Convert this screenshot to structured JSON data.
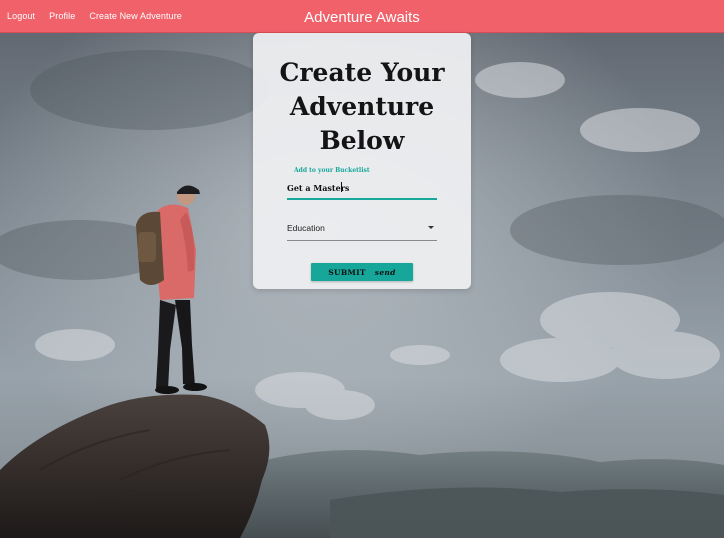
{
  "navbar": {
    "links": [
      "Logout",
      "Profile",
      "Create New Adventure"
    ],
    "brand": "Adventure Awaits",
    "color": "#f0616a"
  },
  "card": {
    "title_lines": [
      "Create Your",
      "Adventure",
      "Below"
    ],
    "field_label": "Add to your Bucketlist",
    "input_value": "Get a Masters",
    "select_value": "Education",
    "submit_label": "SUBMIT",
    "submit_icon_text": "send",
    "accent": "#17a69a"
  },
  "background": {
    "icon": "mountain-hiker-photo"
  }
}
